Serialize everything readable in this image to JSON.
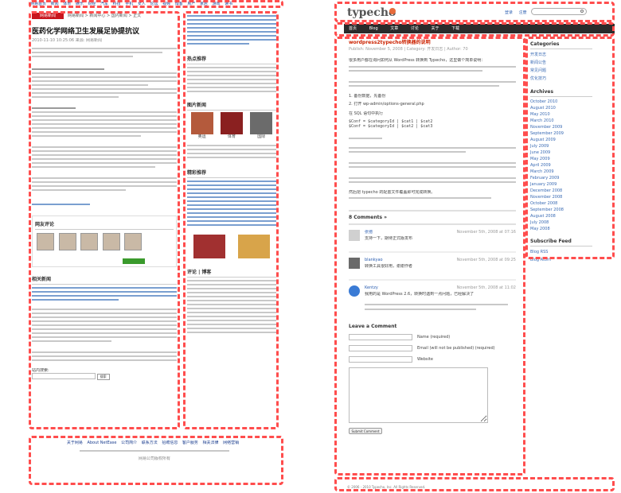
{
  "left": {
    "topnav": [
      "网易首页",
      "新闻",
      "体育",
      "娱乐",
      "财经",
      "汽车",
      "科技",
      "手机",
      "女人",
      "论坛",
      "视频",
      "博客",
      "房产",
      "家居",
      "游戏",
      "读书",
      "彩票",
      "教育",
      "旅游"
    ],
    "logo": "网易新闻",
    "breadcrumb": "网易新闻 > 新闻中心 > 国内新闻 > 正文",
    "article_title": "医药化学网络卫生发展足协提抗议",
    "article_body_note": "2010-11-10 10:25:06 来源: 网易新闻",
    "related_heading": "相关新闻",
    "comments_heading": "网友评论",
    "search_label": "站内搜索:",
    "search_button": "搜索",
    "footer_links": [
      "关于网易",
      "About NetEase",
      "公司简介",
      "联系方法",
      "招聘信息",
      "客户服务",
      "相关法律",
      "网络营销"
    ],
    "copyright": "网易公司版权所有"
  },
  "middle": {
    "sections": [
      "热点推荐",
      "图片新闻",
      "精彩推荐",
      "评论 | 博客"
    ],
    "photo_captions": [
      "奥运",
      "体育",
      "国际"
    ]
  },
  "right": {
    "logo": "typecho",
    "header_links": [
      "登录",
      "注册"
    ],
    "search_placeholder": "",
    "nav": [
      "首页",
      "Blog",
      "文章",
      "讨论",
      "关于",
      "下载"
    ],
    "post_title": "wordpress2typecho转换器的说明",
    "post_meta": "Publish: November 5, 2008 | Category: 开发日志 | Author: 70",
    "post_body": [
      "很多用户都在询问如何从 WordPress 转换到 Typecho，这里做个简单说明：",
      "1. 备份数据，先备份",
      "2. 打开 wp-admin/options-general.php",
      "在 SQL 语句中执行",
      "$Conf = $categoryId | $cat1 | $cat2",
      "$Conf = $categoryId | $cat2 | $cat3",
      "然后把 typecho 的配置文件覆盖即可完成转换。"
    ],
    "comments_count_label": "8 Comments »",
    "comments": [
      {
        "author": "张弛",
        "date": "November 5th, 2008 at 07:16",
        "text": "支持一下，期待正式版发布"
      },
      {
        "author": "blankyao",
        "date": "November 5th, 2008 at 09:25",
        "text": "转换工具很好用，谢谢作者"
      },
      {
        "author": "Kentzy",
        "date": "November 5th, 2008 at 11:02",
        "text": "我用的是 WordPress 2.6，转换时遇到一点问题，已经解决了"
      }
    ],
    "leave_comment": "Leave a Comment",
    "form_labels": [
      "Name (required)",
      "Email (will not be published) (required)",
      "Website"
    ],
    "submit": "Submit Comment",
    "sidebar": {
      "categories_title": "Categories",
      "categories": [
        "开发日志",
        "新闻公告",
        "常见问题",
        "优化技巧"
      ],
      "archives_title": "Archives",
      "archives": [
        "October 2010",
        "August 2010",
        "May 2010",
        "March 2010",
        "November 2009",
        "September 2009",
        "August 2009",
        "July 2009",
        "June 2009",
        "May 2009",
        "April 2009",
        "March 2009",
        "February 2009",
        "January 2009",
        "December 2008",
        "November 2008",
        "October 2008",
        "September 2008",
        "August 2008",
        "July 2008",
        "May 2008"
      ],
      "feed_title": "Subscribe Feed",
      "feeds": [
        "Blog RSS",
        "Blog Atom"
      ]
    },
    "footer": "© 2006 - 2010 Typecho, Inc. All Rights Reserved."
  }
}
